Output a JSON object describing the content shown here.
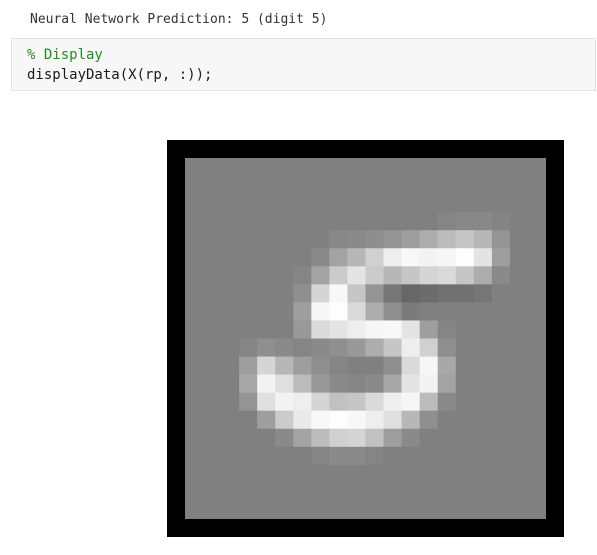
{
  "output": {
    "prediction_text": "Neural Network Prediction: 5 (digit 5)"
  },
  "code": {
    "lines": [
      "% Display",
      "displayData(X(rp, :));"
    ]
  },
  "figure": {
    "background_gray": 128,
    "pixels": [
      [
        0,
        0,
        0,
        0,
        0,
        0,
        0,
        0,
        0,
        0,
        0,
        0,
        0,
        0,
        0,
        0,
        0,
        0,
        0,
        0
      ],
      [
        0,
        0,
        0,
        0,
        0,
        0,
        0,
        0,
        0,
        0,
        0,
        0,
        0,
        0,
        0,
        0,
        0,
        0,
        0,
        0
      ],
      [
        0,
        0,
        0,
        0,
        0,
        0,
        0,
        0,
        0,
        0,
        0,
        0,
        0,
        0,
        0,
        0,
        0,
        0,
        0,
        0
      ],
      [
        0,
        0,
        0,
        0,
        0,
        0,
        0,
        0,
        0,
        0,
        0,
        0,
        0,
        0,
        5,
        8,
        8,
        4,
        0,
        0
      ],
      [
        0,
        0,
        0,
        0,
        0,
        0,
        0,
        0,
        8,
        10,
        14,
        20,
        30,
        45,
        60,
        70,
        55,
        20,
        0,
        0
      ],
      [
        0,
        0,
        0,
        0,
        0,
        0,
        0,
        10,
        35,
        55,
        80,
        110,
        120,
        115,
        118,
        125,
        100,
        30,
        0,
        0
      ],
      [
        0,
        0,
        0,
        0,
        0,
        0,
        5,
        35,
        75,
        100,
        75,
        55,
        70,
        85,
        90,
        70,
        45,
        10,
        0,
        0
      ],
      [
        0,
        0,
        0,
        0,
        0,
        0,
        15,
        85,
        120,
        70,
        20,
        -10,
        -25,
        -20,
        -15,
        -15,
        -10,
        0,
        0,
        0
      ],
      [
        0,
        0,
        0,
        0,
        0,
        0,
        30,
        118,
        125,
        90,
        45,
        15,
        -5,
        0,
        0,
        0,
        0,
        0,
        0,
        0
      ],
      [
        0,
        0,
        0,
        0,
        0,
        0,
        25,
        90,
        100,
        110,
        118,
        120,
        100,
        30,
        5,
        0,
        0,
        0,
        0,
        0
      ],
      [
        0,
        0,
        0,
        5,
        15,
        10,
        5,
        10,
        15,
        25,
        45,
        70,
        110,
        80,
        15,
        0,
        0,
        0,
        0,
        0
      ],
      [
        0,
        0,
        0,
        30,
        85,
        55,
        30,
        15,
        5,
        0,
        0,
        15,
        90,
        118,
        40,
        0,
        0,
        0,
        0,
        0
      ],
      [
        0,
        0,
        0,
        40,
        115,
        95,
        60,
        25,
        10,
        5,
        10,
        40,
        100,
        115,
        35,
        0,
        0,
        0,
        0,
        0
      ],
      [
        0,
        0,
        0,
        20,
        95,
        115,
        110,
        85,
        65,
        70,
        90,
        110,
        118,
        60,
        10,
        0,
        0,
        0,
        0,
        0
      ],
      [
        0,
        0,
        0,
        0,
        30,
        75,
        105,
        120,
        125,
        120,
        110,
        95,
        55,
        15,
        0,
        0,
        0,
        0,
        0,
        0
      ],
      [
        0,
        0,
        0,
        0,
        0,
        10,
        35,
        60,
        80,
        85,
        65,
        30,
        10,
        0,
        0,
        0,
        0,
        0,
        0,
        0
      ],
      [
        0,
        0,
        0,
        0,
        0,
        0,
        0,
        5,
        10,
        10,
        5,
        0,
        0,
        0,
        0,
        0,
        0,
        0,
        0,
        0
      ],
      [
        0,
        0,
        0,
        0,
        0,
        0,
        0,
        0,
        0,
        0,
        0,
        0,
        0,
        0,
        0,
        0,
        0,
        0,
        0,
        0
      ],
      [
        0,
        0,
        0,
        0,
        0,
        0,
        0,
        0,
        0,
        0,
        0,
        0,
        0,
        0,
        0,
        0,
        0,
        0,
        0,
        0
      ],
      [
        0,
        0,
        0,
        0,
        0,
        0,
        0,
        0,
        0,
        0,
        0,
        0,
        0,
        0,
        0,
        0,
        0,
        0,
        0,
        0
      ]
    ]
  }
}
